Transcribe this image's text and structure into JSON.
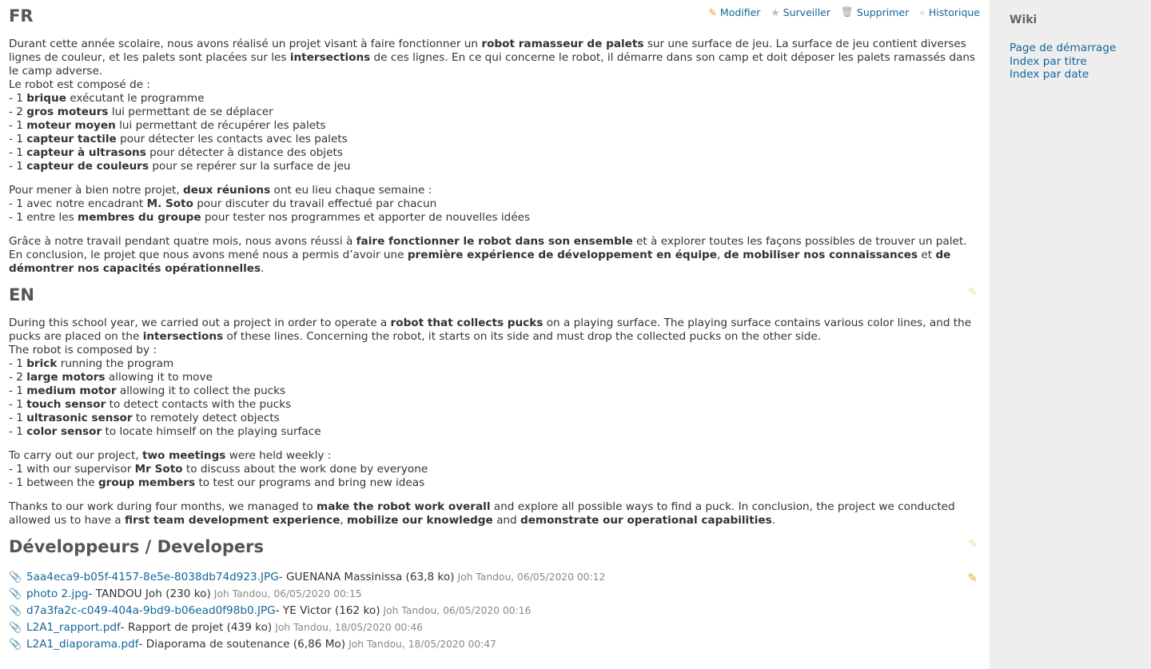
{
  "toolbar": {
    "edit": "Modifier",
    "watch": "Surveiller",
    "delete": "Supprimer",
    "history": "Historique"
  },
  "sidebar": {
    "title": "Wiki",
    "links": [
      "Page de démarrage",
      "Index par titre",
      "Index par date"
    ]
  },
  "fr": {
    "heading": "FR",
    "intro": [
      {
        "t": "Durant cette année scolaire, nous avons réalisé un projet visant à faire fonctionner un "
      },
      {
        "t": "robot ramasseur de palets",
        "b": true
      },
      {
        "t": " sur une surface de jeu. La surface de jeu contient diverses lignes de couleur, et les palets sont placées sur les "
      },
      {
        "t": "intersections",
        "b": true
      },
      {
        "t": " de ces lignes. En ce qui concerne le robot, il démarre dans son camp et doit déposer les palets ramassés dans le camp adverse."
      }
    ],
    "composed": "Le robot est composé de :",
    "components": [
      [
        {
          "t": "- 1 "
        },
        {
          "t": "brique",
          "b": true
        },
        {
          "t": " exécutant le programme"
        }
      ],
      [
        {
          "t": "- 2 "
        },
        {
          "t": "gros moteurs",
          "b": true
        },
        {
          "t": " lui permettant de se déplacer"
        }
      ],
      [
        {
          "t": "- 1 "
        },
        {
          "t": "moteur moyen",
          "b": true
        },
        {
          "t": " lui permettant de récupérer les palets"
        }
      ],
      [
        {
          "t": "- 1 "
        },
        {
          "t": "capteur tactile",
          "b": true
        },
        {
          "t": " pour détecter les contacts avec les palets"
        }
      ],
      [
        {
          "t": "- 1 "
        },
        {
          "t": "capteur à ultrasons",
          "b": true
        },
        {
          "t": " pour détecter à distance des objets"
        }
      ],
      [
        {
          "t": "- 1 "
        },
        {
          "t": "capteur de couleurs",
          "b": true
        },
        {
          "t": " pour se repérer sur la surface de jeu"
        }
      ]
    ],
    "meetings": [
      [
        {
          "t": "Pour mener à bien notre projet, "
        },
        {
          "t": "deux réunions",
          "b": true
        },
        {
          "t": " ont eu lieu chaque semaine :"
        }
      ],
      [
        {
          "t": "- 1 avec notre encadrant "
        },
        {
          "t": "M. Soto",
          "b": true
        },
        {
          "t": " pour discuter du travail effectué par chacun"
        }
      ],
      [
        {
          "t": "- 1 entre les "
        },
        {
          "t": "membres du groupe",
          "b": true
        },
        {
          "t": " pour tester nos programmes et apporter de nouvelles idées"
        }
      ]
    ],
    "conclusion": [
      {
        "t": "Grâce à notre travail pendant quatre mois, nous avons réussi à "
      },
      {
        "t": "faire fonctionner le robot dans son ensemble",
        "b": true
      },
      {
        "t": " et à explorer toutes les façons possibles de trouver un palet. En conclusion, le projet que nous avons mené nous a permis d’avoir une "
      },
      {
        "t": "première expérience de développement en équipe",
        "b": true
      },
      {
        "t": ", "
      },
      {
        "t": "de mobiliser nos connaissances",
        "b": true
      },
      {
        "t": " et "
      },
      {
        "t": "de démontrer nos capacités opérationnelles",
        "b": true
      },
      {
        "t": "."
      }
    ]
  },
  "en": {
    "heading": "EN",
    "intro": [
      {
        "t": "During this school year, we carried out a project in order to operate a "
      },
      {
        "t": "robot that collects pucks",
        "b": true
      },
      {
        "t": " on a playing surface. The playing surface contains various color lines, and the pucks are placed on the "
      },
      {
        "t": "intersections",
        "b": true
      },
      {
        "t": " of these lines. Concerning the robot, it starts on its side and must drop the collected pucks on the other side."
      }
    ],
    "composed": "The robot is composed by :",
    "components": [
      [
        {
          "t": "- 1 "
        },
        {
          "t": "brick",
          "b": true
        },
        {
          "t": " running the program"
        }
      ],
      [
        {
          "t": "- 2 "
        },
        {
          "t": "large motors",
          "b": true
        },
        {
          "t": " allowing it to move"
        }
      ],
      [
        {
          "t": "- 1 "
        },
        {
          "t": "medium motor",
          "b": true
        },
        {
          "t": " allowing it to collect the pucks"
        }
      ],
      [
        {
          "t": "- 1 "
        },
        {
          "t": "touch sensor",
          "b": true
        },
        {
          "t": " to detect contacts with the pucks"
        }
      ],
      [
        {
          "t": "- 1 "
        },
        {
          "t": "ultrasonic sensor",
          "b": true
        },
        {
          "t": " to remotely detect objects"
        }
      ],
      [
        {
          "t": "- 1 "
        },
        {
          "t": "color sensor",
          "b": true
        },
        {
          "t": " to locate himself on the playing surface"
        }
      ]
    ],
    "meetings": [
      [
        {
          "t": "To carry out our project, "
        },
        {
          "t": "two meetings",
          "b": true
        },
        {
          "t": " were held weekly :"
        }
      ],
      [
        {
          "t": "- 1 with our supervisor "
        },
        {
          "t": "Mr Soto",
          "b": true
        },
        {
          "t": " to discuss about the work done by everyone"
        }
      ],
      [
        {
          "t": "- 1 between the "
        },
        {
          "t": "group members",
          "b": true
        },
        {
          "t": " to test our programs and bring new ideas"
        }
      ]
    ],
    "conclusion": [
      {
        "t": "Thanks to our work during four months, we managed to "
      },
      {
        "t": "make the robot work overall",
        "b": true
      },
      {
        "t": " and explore all possible ways to find a puck. In conclusion, the project we conducted allowed us to have a "
      },
      {
        "t": "first team development experience",
        "b": true
      },
      {
        "t": ", "
      },
      {
        "t": "mobilize our knowledge",
        "b": true
      },
      {
        "t": " and "
      },
      {
        "t": "demonstrate our operational capabilities",
        "b": true
      },
      {
        "t": "."
      }
    ]
  },
  "developers": {
    "heading": "Développeurs / Developers"
  },
  "attachments": [
    {
      "file": "5aa4eca9-b05f-4157-8e5e-8038db74d923.JPG",
      "desc": " - GUENANA Massinissa (63,8 ko)",
      "meta": "Joh Tandou, 06/05/2020 00:12"
    },
    {
      "file": "photo 2.jpg",
      "desc": " - TANDOU Joh (230 ko)",
      "meta": "Joh Tandou, 06/05/2020 00:15"
    },
    {
      "file": "d7a3fa2c-c049-404a-9bd9-b06ead0f98b0.JPG",
      "desc": " - YE Victor (162 ko)",
      "meta": "Joh Tandou, 06/05/2020 00:16"
    },
    {
      "file": "L2A1_rapport.pdf",
      "desc": " - Rapport de projet (439 ko)",
      "meta": "Joh Tandou, 18/05/2020 00:46"
    },
    {
      "file": "L2A1_diaporama.pdf",
      "desc": " - Diaporama de soutenance (6,86 Mo)",
      "meta": "Joh Tandou, 18/05/2020 00:47"
    }
  ],
  "icons": {
    "edit": "pencil-icon",
    "watch": "star-icon",
    "delete": "trash-icon",
    "history": "history-icon",
    "attachment": "paperclip-icon"
  },
  "colors": {
    "link": "#116699",
    "sidebar_bg": "#eeeeee",
    "heading": "#555555"
  }
}
